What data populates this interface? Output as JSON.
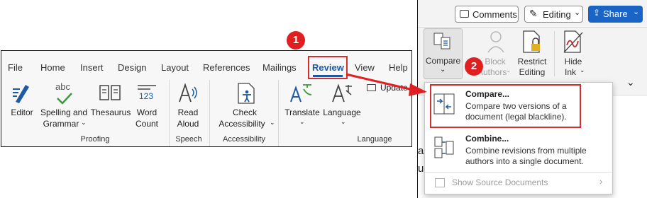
{
  "colors": {
    "accent_blue": "#1c5aa6",
    "annotation_red": "#d32f2f",
    "badge_red": "#e02020",
    "share_blue": "#1a64c6"
  },
  "left_ribbon": {
    "tabs": [
      "File",
      "Home",
      "Insert",
      "Design",
      "Layout",
      "References",
      "Mailings",
      "Review",
      "View",
      "Help"
    ],
    "active_tab": "Review",
    "update_label": "Update",
    "buttons": {
      "editor": "Editor",
      "spelling_line1": "Spelling and",
      "spelling_line2": "Grammar",
      "thesaurus": "Thesaurus",
      "word_count_line1": "Word",
      "word_count_line2": "Count",
      "read_aloud_line1": "Read",
      "read_aloud_line2": "Aloud",
      "check_acc_line1": "Check",
      "check_acc_line2": "Accessibility",
      "translate": "Translate",
      "language": "Language"
    },
    "groups": {
      "proofing": "Proofing",
      "speech": "Speech",
      "accessibility": "Accessibility",
      "language": "Language"
    },
    "icon_text": {
      "abc": "abc",
      "num": "123"
    }
  },
  "right_window": {
    "comments_label": "Comments",
    "editing_label": "Editing",
    "share_label": "Share",
    "compare_label": "Compare",
    "block_authors_line1": "Block",
    "block_authors_line2": "Authors",
    "restrict_line1": "Restrict",
    "restrict_line2": "Editing",
    "hide_ink_line1": "Hide",
    "hide_ink_line2": "Ink"
  },
  "dropdown": {
    "compare_title": "Compare...",
    "compare_desc_line1": "Compare two versions of a",
    "compare_desc_line2": "document (legal blackline).",
    "combine_title": "Combine...",
    "combine_desc_line1": "Combine revisions from multiple",
    "combine_desc_line2": "authors into a single document.",
    "show_source": "Show Source Documents"
  },
  "annotations": {
    "step1": "1",
    "step2": "2"
  },
  "background_text": {
    "frag1": "al",
    "frag2": "ur"
  }
}
